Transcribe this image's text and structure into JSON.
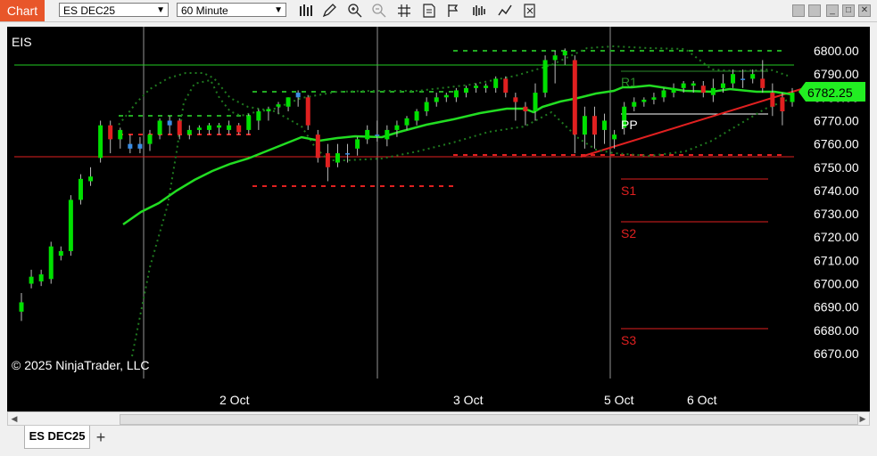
{
  "toolbar": {
    "chart_label": "Chart",
    "instrument": "ES DEC25",
    "interval": "60 Minute",
    "icons": [
      "bars-icon",
      "pencil-icon",
      "zoom-in-icon",
      "zoom-out-icon",
      "crosshair-icon",
      "properties-icon",
      "strategy-icon",
      "indicators-icon",
      "templates-icon",
      "data-series-icon"
    ]
  },
  "chart": {
    "indicator_label": "EIS",
    "copyright": "© 2025 NinjaTrader, LLC",
    "current_price": "6782.25",
    "price_axis_labels": [
      "6800.00",
      "6790.00",
      "6780.00",
      "6770.00",
      "6760.00",
      "6750.00",
      "6740.00",
      "6730.00",
      "6720.00",
      "6710.00",
      "6700.00",
      "6690.00",
      "6680.00",
      "6670.00"
    ],
    "time_axis_labels": [
      "2 Oct",
      "3 Oct",
      "5 Oct",
      "6 Oct"
    ],
    "pivot_labels": [
      "R1",
      "PP",
      "S1",
      "S2",
      "S3"
    ],
    "colors": {
      "up": "#00e000",
      "down": "#e02020",
      "neutral": "#3a8ee6",
      "ma": "#22dd22",
      "background": "#000000",
      "accent": "#e8562a"
    }
  },
  "chart_data": {
    "type": "candlestick",
    "ylim": [
      6665,
      6805
    ],
    "candles": [
      [
        6688,
        6692,
        6684,
        6696
      ],
      [
        6700,
        6703,
        6698,
        6706
      ],
      [
        6701,
        6704,
        6699,
        6706
      ],
      [
        6702,
        6716,
        6700,
        6718
      ],
      [
        6712,
        6714,
        6710,
        6716
      ],
      [
        6714,
        6736,
        6712,
        6738
      ],
      [
        6736,
        6745,
        6734,
        6747
      ],
      [
        6744,
        6746,
        6742,
        6750
      ],
      [
        6754,
        6768,
        6752,
        6770
      ],
      [
        6768,
        6762,
        6756,
        6770
      ],
      [
        6762,
        6766,
        6758,
        6767
      ],
      [
        6760,
        6758,
        6756,
        6764
      ],
      [
        6758,
        6760,
        6756,
        6763
      ],
      [
        6760,
        6764,
        6757,
        6766
      ],
      [
        6764,
        6770,
        6762,
        6771
      ],
      [
        6768,
        6770,
        6764,
        6772
      ],
      [
        6770,
        6764,
        6762,
        6771
      ],
      [
        6764,
        6766,
        6762,
        6768
      ],
      [
        6766,
        6767,
        6764,
        6768
      ],
      [
        6766,
        6768,
        6764,
        6769
      ],
      [
        6767,
        6768,
        6764,
        6769
      ],
      [
        6766,
        6768,
        6764,
        6770
      ],
      [
        6768,
        6765,
        6764,
        6769
      ],
      [
        6766,
        6772,
        6764,
        6773
      ],
      [
        6770,
        6774,
        6766,
        6775
      ],
      [
        6774,
        6775,
        6770,
        6776
      ],
      [
        6776,
        6777,
        6773,
        6778
      ],
      [
        6776,
        6780,
        6774,
        6780
      ],
      [
        6780,
        6782,
        6776,
        6783
      ],
      [
        6780,
        6768,
        6766,
        6781
      ],
      [
        6764,
        6754,
        6752,
        6766
      ],
      [
        6756,
        6750,
        6744,
        6760
      ],
      [
        6752,
        6756,
        6750,
        6760
      ],
      [
        6756,
        6756,
        6752,
        6760
      ],
      [
        6758,
        6762,
        6755,
        6763
      ],
      [
        6762,
        6766,
        6760,
        6768
      ],
      [
        6764,
        6764,
        6761,
        6770
      ],
      [
        6762,
        6766,
        6759,
        6768
      ],
      [
        6766,
        6768,
        6763,
        6770
      ],
      [
        6768,
        6771,
        6766,
        6772
      ],
      [
        6770,
        6774,
        6768,
        6775
      ],
      [
        6774,
        6778,
        6772,
        6780
      ],
      [
        6778,
        6780,
        6776,
        6782
      ],
      [
        6780,
        6781,
        6778,
        6782
      ],
      [
        6780,
        6783,
        6778,
        6784
      ],
      [
        6782,
        6784,
        6780,
        6785
      ],
      [
        6784,
        6785,
        6782,
        6786
      ],
      [
        6784,
        6785,
        6782,
        6786
      ],
      [
        6784,
        6788,
        6782,
        6789
      ],
      [
        6788,
        6782,
        6780,
        6789
      ],
      [
        6780,
        6778,
        6770,
        6782
      ],
      [
        6776,
        6774,
        6768,
        6778
      ],
      [
        6774,
        6782,
        6770,
        6786
      ],
      [
        6782,
        6796,
        6780,
        6798
      ],
      [
        6796,
        6798,
        6786,
        6800
      ],
      [
        6798,
        6800,
        6794,
        6801
      ],
      [
        6796,
        6764,
        6756,
        6798
      ],
      [
        6764,
        6772,
        6758,
        6776
      ],
      [
        6772,
        6764,
        6758,
        6776
      ],
      [
        6766,
        6770,
        6760,
        6773
      ],
      [
        6762,
        6764,
        6758,
        6766
      ],
      [
        6767,
        6776,
        6764,
        6778
      ],
      [
        6776,
        6778,
        6774,
        6780
      ],
      [
        6778,
        6779,
        6776,
        6780
      ],
      [
        6779,
        6780,
        6777,
        6782
      ],
      [
        6780,
        6783,
        6778,
        6784
      ],
      [
        6782,
        6784,
        6780,
        6786
      ],
      [
        6784,
        6786,
        6782,
        6787
      ],
      [
        6785,
        6786,
        6782,
        6787
      ],
      [
        6785,
        6782,
        6780,
        6787
      ],
      [
        6781,
        6784,
        6778,
        6788
      ],
      [
        6784,
        6786,
        6782,
        6790
      ],
      [
        6786,
        6790,
        6784,
        6792
      ],
      [
        6788,
        6788,
        6784,
        6792
      ],
      [
        6788,
        6790,
        6786,
        6792
      ],
      [
        6788,
        6784,
        6782,
        6796
      ],
      [
        6782,
        6776,
        6772,
        6786
      ],
      [
        6780,
        6774,
        6768,
        6782
      ],
      [
        6778,
        6782,
        6776,
        6784
      ]
    ]
  }
}
